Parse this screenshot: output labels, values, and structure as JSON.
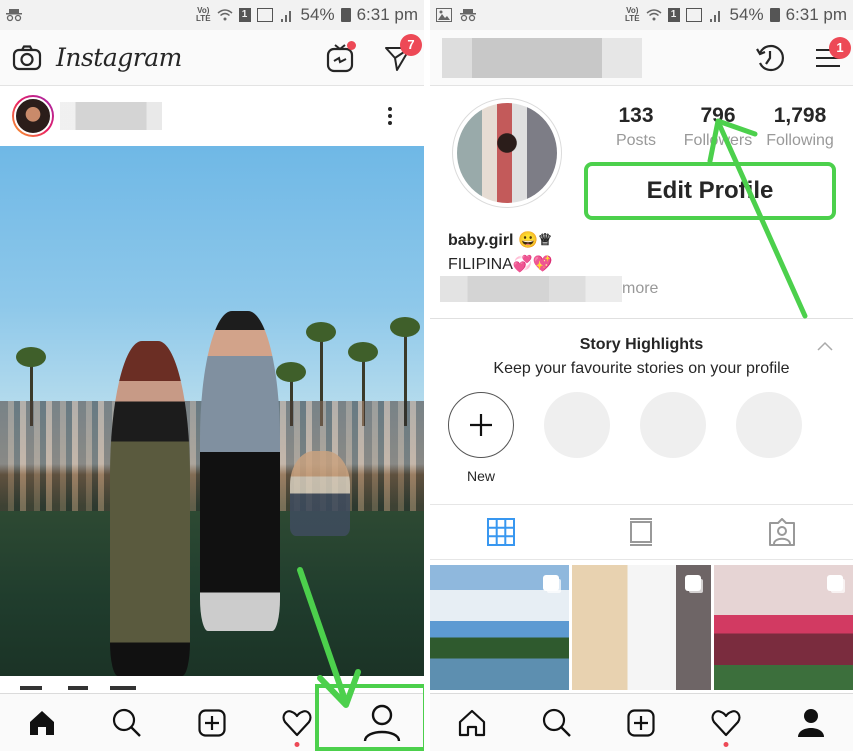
{
  "status_bar": {
    "left": {
      "battery_percent": "54%",
      "time": "6:31 pm",
      "sim": "1",
      "network": "VoLTE"
    },
    "right": {
      "battery_percent": "54%",
      "time": "6:31 pm",
      "sim": "1",
      "network": "VoLTE"
    }
  },
  "feed": {
    "app_name": "Instagram",
    "direct_badge": "7",
    "icons": [
      "camera-icon",
      "igtv-icon",
      "direct-message-icon"
    ],
    "post": {
      "username": "",
      "menu_icon": "more-options-icon"
    }
  },
  "profile": {
    "username": "",
    "notifications_badge": "1",
    "stats": [
      {
        "value": "133",
        "label": "Posts"
      },
      {
        "value": "796",
        "label": "Followers"
      },
      {
        "value": "1,798",
        "label": "Following"
      }
    ],
    "edit_profile_label": "Edit Profile",
    "bio": {
      "name": "baby.girl 😀♕",
      "tagline": "FILIPINA💞💖",
      "more_label": "more"
    },
    "highlights": {
      "title": "Story Highlights",
      "subtitle": "Keep your favourite stories on your profile",
      "new_label": "New",
      "placeholder_count": 3
    },
    "content_tabs": [
      "grid",
      "feed",
      "tagged"
    ],
    "active_content_tab": "grid",
    "thumbnails": 3
  },
  "bottom_nav": {
    "items": [
      "home",
      "search",
      "new-post",
      "activity",
      "profile"
    ],
    "left_active": "home",
    "right_active": "profile"
  },
  "annotations": {
    "color": "#4cd04c"
  }
}
